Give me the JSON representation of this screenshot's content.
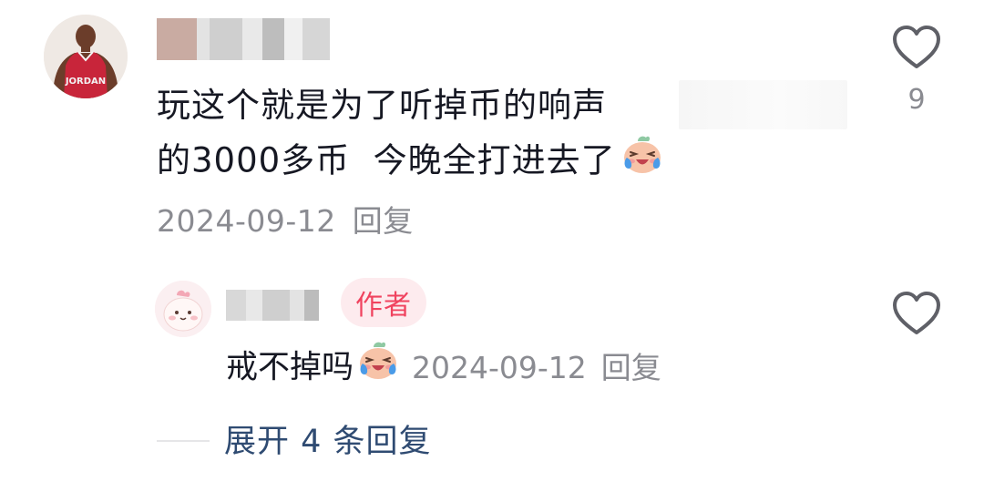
{
  "comment": {
    "text_line1": "玩这个就是为了听掉币的响声",
    "text_line2": "的3000多币  今晚全打进去了",
    "date": "2024-09-12",
    "reply_label": "回复",
    "like_count": "9",
    "avatar_jersey_text": "JORDAN"
  },
  "reply": {
    "badge": "作者",
    "text": "戒不掉吗",
    "date": "2024-09-12",
    "reply_label": "回复"
  },
  "expand": {
    "label": "展开 4 条回复"
  },
  "icons": {
    "like": "heart-outline-icon",
    "emoji": "crying-laughing-emoji"
  },
  "colors": {
    "text": "#161823",
    "meta": "#8a8b91",
    "author_badge_bg": "#fdebee",
    "author_badge_text": "#f0435f",
    "expand_link": "#2f4b72"
  }
}
